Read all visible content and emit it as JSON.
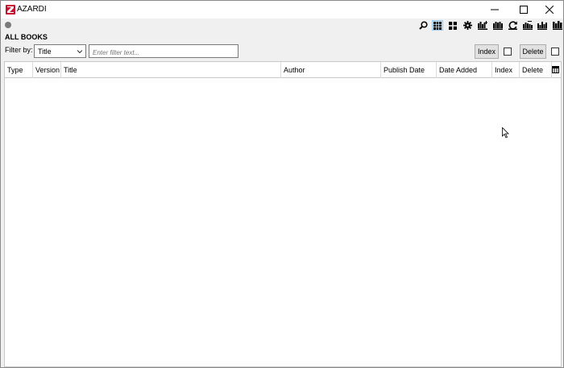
{
  "window": {
    "title": "AZARDI"
  },
  "section": {
    "title": "ALL BOOKS"
  },
  "filter": {
    "label": "Filter by:",
    "selected": "Title",
    "placeholder": "Enter filter text..."
  },
  "buttons": {
    "index": "Index",
    "delete": "Delete"
  },
  "table": {
    "columns": [
      "Type",
      "Version",
      "Title",
      "Author",
      "Publish Date",
      "Date Added",
      "Index",
      "Delete"
    ],
    "rows": []
  },
  "toolbar": {
    "icons": [
      "search-icon",
      "list-view-icon",
      "grid-view-icon",
      "gear-icon",
      "library-add-icon",
      "library-import-icon",
      "sync-icon",
      "library-remove-icon",
      "library-sort-icon",
      "bookshelf-icon"
    ],
    "active_icon": "list-view-icon"
  },
  "colors": {
    "logo": "#c8102e",
    "active_tool": "#cce4f7"
  }
}
